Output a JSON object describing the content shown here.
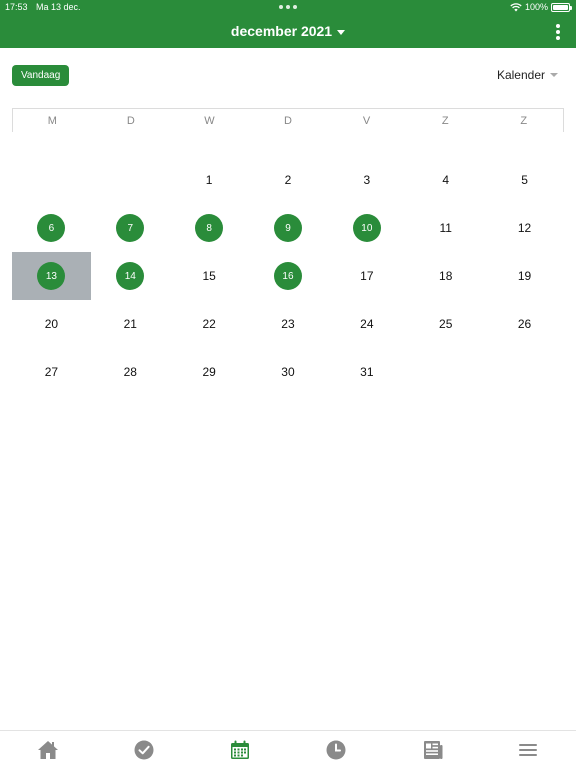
{
  "status": {
    "time": "17:53",
    "date": "Ma 13 dec.",
    "battery": "100%",
    "battery_level": 1.0
  },
  "header": {
    "month_title": "december 2021"
  },
  "toolbar": {
    "today_label": "Vandaag",
    "view_label": "Kalender"
  },
  "weekdays": [
    "M",
    "D",
    "W",
    "D",
    "V",
    "Z",
    "Z"
  ],
  "calendar": {
    "leading_blanks": 2,
    "days": [
      {
        "d": "1"
      },
      {
        "d": "2"
      },
      {
        "d": "3"
      },
      {
        "d": "4"
      },
      {
        "d": "5"
      },
      {
        "d": "6",
        "marked": true
      },
      {
        "d": "7",
        "marked": true
      },
      {
        "d": "8",
        "marked": true
      },
      {
        "d": "9",
        "marked": true
      },
      {
        "d": "10",
        "marked": true
      },
      {
        "d": "11"
      },
      {
        "d": "12"
      },
      {
        "d": "13",
        "marked": true,
        "selected": true
      },
      {
        "d": "14",
        "marked": true
      },
      {
        "d": "15"
      },
      {
        "d": "16",
        "marked": true
      },
      {
        "d": "17"
      },
      {
        "d": "18"
      },
      {
        "d": "19"
      },
      {
        "d": "20"
      },
      {
        "d": "21"
      },
      {
        "d": "22"
      },
      {
        "d": "23"
      },
      {
        "d": "24"
      },
      {
        "d": "25"
      },
      {
        "d": "26"
      },
      {
        "d": "27"
      },
      {
        "d": "28"
      },
      {
        "d": "29"
      },
      {
        "d": "30"
      },
      {
        "d": "31"
      }
    ]
  },
  "tabs": [
    {
      "icon": "home-icon",
      "active": false
    },
    {
      "icon": "check-circle-icon",
      "active": false
    },
    {
      "icon": "calendar-icon",
      "active": true
    },
    {
      "icon": "clock-icon",
      "active": false
    },
    {
      "icon": "newspaper-icon",
      "active": false
    },
    {
      "icon": "menu-icon",
      "active": false
    }
  ],
  "colors": {
    "accent": "#2a8c3a",
    "selected_bg": "#aab0b5",
    "tab_inactive": "#8a8a8a"
  }
}
